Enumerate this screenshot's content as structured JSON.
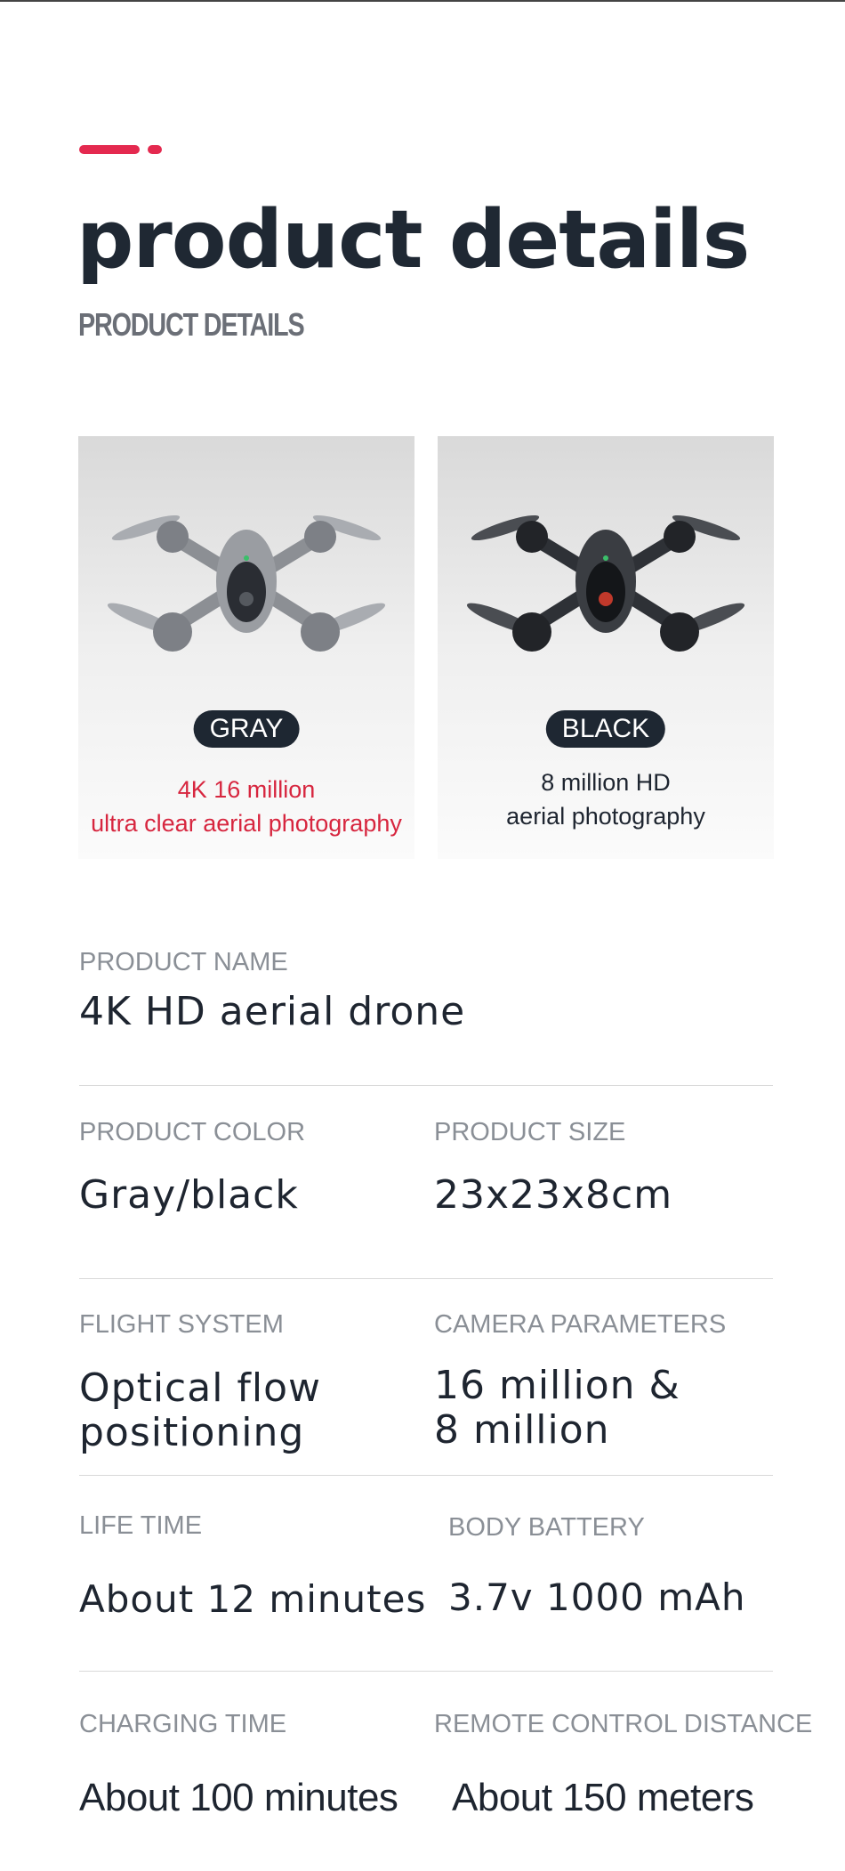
{
  "header": {
    "title": "product details",
    "subtitle": "PRODUCT DETAILS",
    "accent_color": "#e4294f"
  },
  "variants": [
    {
      "badge": "GRAY",
      "desc_line1": "4K 16 million",
      "desc_line2": "ultra clear aerial photography",
      "text_color": "#d7263f"
    },
    {
      "badge": "BLACK",
      "desc_line1": "8 million HD",
      "desc_line2": "aerial photography",
      "text_color": "#1e2530"
    }
  ],
  "specs": {
    "product_name": {
      "label": "PRODUCT NAME",
      "value": "4K HD aerial drone"
    },
    "product_color": {
      "label": "PRODUCT COLOR",
      "value": "Gray/black"
    },
    "product_size": {
      "label": "PRODUCT SIZE",
      "value": "23x23x8cm"
    },
    "flight_system": {
      "label": "FLIGHT SYSTEM",
      "value_line1": "Optical flow",
      "value_line2": "positioning"
    },
    "camera_parameters": {
      "label": "CAMERA PARAMETERS",
      "value_line1": "16 million &",
      "value_line2": "8 million"
    },
    "life_time": {
      "label": "LIFE TIME",
      "value": "About 12 minutes"
    },
    "body_battery": {
      "label": "BODY BATTERY",
      "value": "3.7v 1000 mAh"
    },
    "charging_time": {
      "label": "CHARGING TIME",
      "value": "About 100 minutes"
    },
    "remote_control_distance": {
      "label": "REMOTE CONTROL DISTANCE",
      "value": "About 150 meters"
    }
  }
}
